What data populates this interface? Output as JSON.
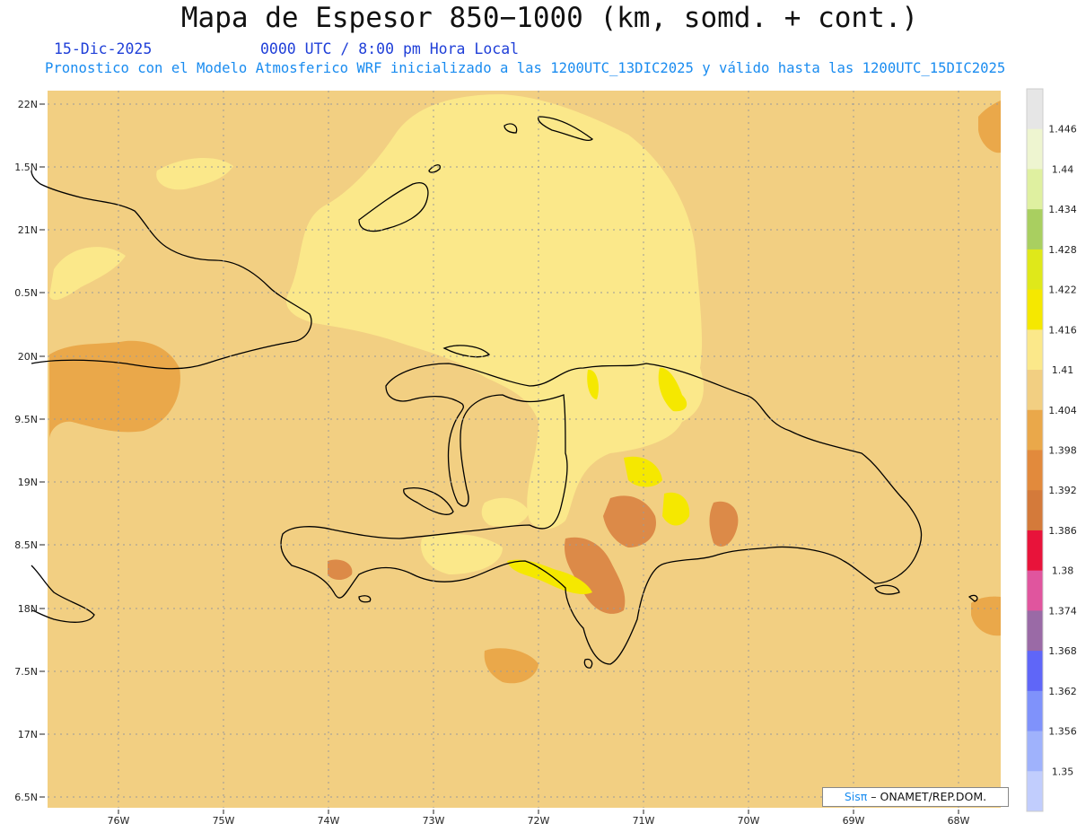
{
  "title": "Mapa de Espesor 850−1000 (km, somd. + cont.)",
  "date": "15-Dic-2025",
  "time": "0000 UTC / 8:00 pm Hora Local",
  "description": "Pronostico con el Modelo Atmosferico WRF inicializado a las 1200UTC_13DIC2025 y válido hasta las  1200UTC_15DIC2025",
  "credit": {
    "logo": "Sisπ",
    "org": "– ONAMET/REP.DOM."
  },
  "axes": {
    "lat_labels": [
      "22N",
      "1.5N",
      "21N",
      "0.5N",
      "20N",
      "9.5N",
      "19N",
      "8.5N",
      "18N",
      "7.5N",
      "17N",
      "6.5N"
    ],
    "lon_labels": [
      "76W",
      "75W",
      "74W",
      "73W",
      "72W",
      "71W",
      "70W",
      "69W",
      "68W"
    ]
  },
  "colorbar": {
    "labels": [
      "1.446",
      "1.44",
      "1.434",
      "1.428",
      "1.422",
      "1.416",
      "1.41",
      "1.404",
      "1.398",
      "1.392",
      "1.386",
      "1.38",
      "1.374",
      "1.368",
      "1.362",
      "1.356",
      "1.35"
    ],
    "colors": [
      "#e6e6e6",
      "#eef5d0",
      "#dff0a0",
      "#a9cf60",
      "#dfe81a",
      "#f5e800",
      "#fbe88a",
      "#f2cf82",
      "#eaa84a",
      "#e28a3c",
      "#d47a3a",
      "#e8133a",
      "#e0559e",
      "#9a6aa6",
      "#5f66f8",
      "#7f92fb",
      "#9fb2fc",
      "#c1cdfd"
    ]
  },
  "colors": {
    "base": "#f2cf82",
    "light": "#fbe88a",
    "mid": "#eaa84a",
    "dark": "#dc8a48",
    "yellow": "#f5e800",
    "coast": "#000000",
    "grid": "#9a9a9a"
  }
}
